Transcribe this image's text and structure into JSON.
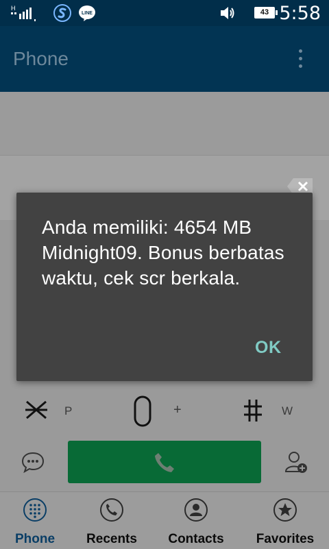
{
  "status_bar": {
    "network_label": "H",
    "time": "5:58",
    "battery_level": "43",
    "icons": [
      "signal-icon",
      "s-app-icon",
      "line-app-icon",
      "volume-icon",
      "battery-icon"
    ],
    "line_label": "LINE"
  },
  "app_bar": {
    "title": "Phone",
    "menu_icon": "overflow-menu-icon"
  },
  "dialpad": {
    "star_sub": "P",
    "zero_sub": "+",
    "hash_sub": "W"
  },
  "dialog": {
    "message": "Anda memiliki: 4654 MB Midnight09. Bonus berbatas waktu, cek scr berkala.",
    "ok_label": "OK"
  },
  "tabs": [
    {
      "label": "Phone",
      "icon": "dialpad-icon",
      "active": true
    },
    {
      "label": "Recents",
      "icon": "recents-phone-icon",
      "active": false
    },
    {
      "label": "Contacts",
      "icon": "contact-icon",
      "active": false
    },
    {
      "label": "Favorites",
      "icon": "star-icon",
      "active": false
    }
  ],
  "colors": {
    "status_bar": "#012e4a",
    "app_bar": "#023453",
    "dialog_bg": "#424242",
    "ok_accent": "#80cbc4",
    "call_button": "#086a36",
    "active_tab": "#0a3e66"
  }
}
